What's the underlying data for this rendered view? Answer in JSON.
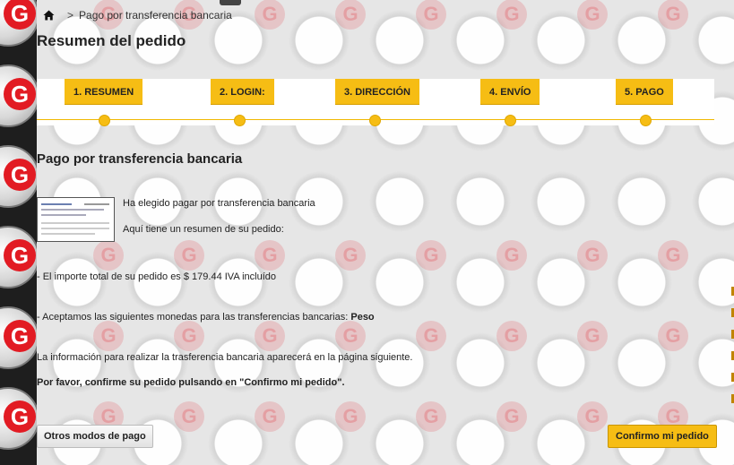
{
  "breadcrumb": {
    "home_icon": "home-icon",
    "separator": ">",
    "current": "Pago por transferencia bancaria"
  },
  "page_title": "Resumen del pedido",
  "steps": [
    {
      "label": "1. RESUMEN"
    },
    {
      "label": "2. LOGIN:"
    },
    {
      "label": "3. DIRECCIÓN"
    },
    {
      "label": "4. ENVÍO"
    },
    {
      "label": "5. PAGO"
    }
  ],
  "section_title": "Pago por transferencia bancaria",
  "payment": {
    "chosen_text": "Ha elegido pagar por transferencia bancaria",
    "summary_text": "Aquí tiene un resumen de su pedido:",
    "total_text": "- El importe total de su pedido es $ 179.44 IVA incluído",
    "currencies_prefix": "- Aceptamos las siguientes monedas para las transferencias bancarias:",
    "currency": "Peso",
    "info_text": "La información para realizar la trasferencia bancaria aparecerá en la página siguiente.",
    "confirm_prompt": "Por favor, confirme su pedido pulsando en \"Confirmo mi pedido\"."
  },
  "buttons": {
    "other_methods": "Otros modos de pago",
    "confirm": "Confirmo mi pedido"
  },
  "colors": {
    "accent": "#f6bd14",
    "brand_red": "#e21b23",
    "side_strip": "#1e1e1e"
  }
}
